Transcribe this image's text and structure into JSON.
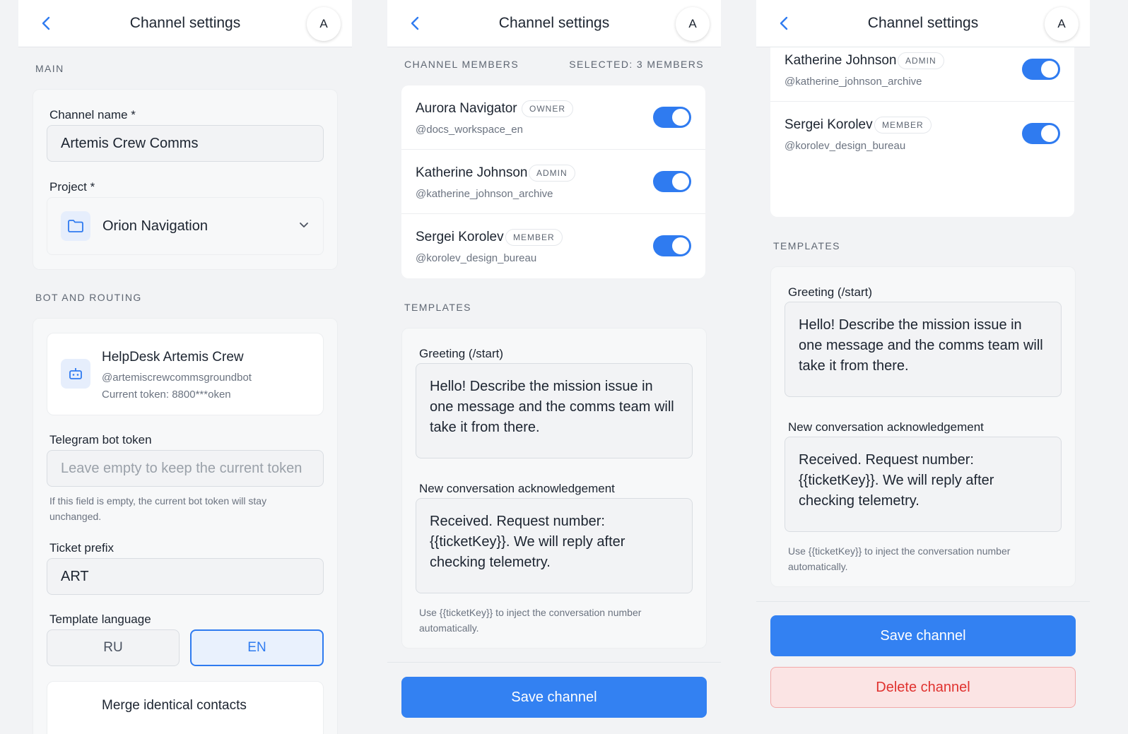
{
  "header": {
    "title": "Channel settings",
    "avatar_letter": "A"
  },
  "main": {
    "section_label": "MAIN",
    "channel_name_label": "Channel name *",
    "channel_name_value": "Artemis Crew Comms",
    "project_label": "Project *",
    "project_value": "Orion Navigation"
  },
  "bot": {
    "section_label": "BOT AND ROUTING",
    "name": "HelpDesk Artemis Crew",
    "handle": "@artemiscrewcommsgroundbot",
    "token_info": "Current token: 8800***oken",
    "token_label": "Telegram bot token",
    "token_placeholder": "Leave empty to keep the current token",
    "token_hint": "If this field is empty, the current bot token will stay unchanged.",
    "prefix_label": "Ticket prefix",
    "prefix_value": "ART",
    "language_label": "Template language",
    "languages": [
      "RU",
      "EN"
    ],
    "selected_language": "EN",
    "merge_label": "Merge identical contacts"
  },
  "members": {
    "section_label": "CHANNEL MEMBERS",
    "selected_text": "SELECTED: 3 MEMBERS",
    "list": [
      {
        "name": "Aurora Navigator",
        "role": "OWNER",
        "handle": "@docs_workspace_en",
        "enabled": true
      },
      {
        "name": "Katherine Johnson",
        "role": "ADMIN",
        "handle": "@katherine_johnson_archive",
        "enabled": true
      },
      {
        "name": "Sergei Korolev",
        "role": "MEMBER",
        "handle": "@korolev_design_bureau",
        "enabled": true
      }
    ]
  },
  "templates": {
    "section_label": "TEMPLATES",
    "greeting_label": "Greeting (/start)",
    "greeting_text": "Hello! Describe the mission issue in one message and the comms team will take it from there.",
    "ack_label": "New conversation acknowledgement",
    "ack_text": "Received. Request number: {{ticketKey}}. We will reply after checking telemetry.",
    "hint": "Use {{ticketKey}} to inject the conversation number automatically."
  },
  "actions": {
    "save": "Save channel",
    "delete": "Delete channel"
  },
  "colors": {
    "accent": "#3381f2",
    "danger": "#e0322f",
    "danger_bg": "#fbe4e4"
  }
}
